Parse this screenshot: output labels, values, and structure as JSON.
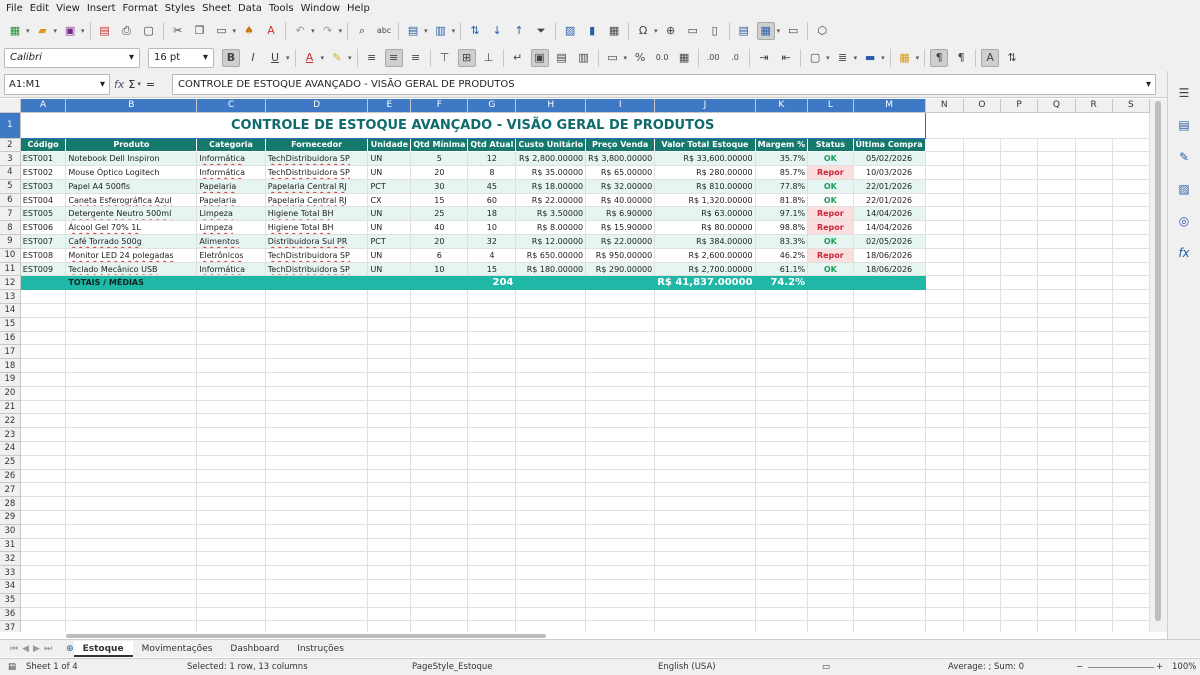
{
  "menu": [
    "File",
    "Edit",
    "View",
    "Insert",
    "Format",
    "Styles",
    "Sheet",
    "Data",
    "Tools",
    "Window",
    "Help"
  ],
  "toolbar": {
    "font_name": "Calibri",
    "font_size": "16 pt"
  },
  "formula_bar": {
    "cell_ref": "A1:M1",
    "fx": "fx",
    "sum": "Σ",
    "eq": "=",
    "content": "CONTROLE DE ESTOQUE AVANÇADO - VISÃO GERAL DE PRODUTOS"
  },
  "columns": [
    "A",
    "B",
    "C",
    "D",
    "E",
    "F",
    "G",
    "H",
    "I",
    "J",
    "K",
    "L",
    "M",
    "N",
    "O",
    "P",
    "Q",
    "R",
    "S"
  ],
  "sheet": {
    "title": "CONTROLE DE ESTOQUE AVANÇADO - VISÃO GERAL DE PRODUTOS",
    "headers": [
      "Código",
      "Produto",
      "Categoria",
      "Fornecedor",
      "Unidade",
      "Qtd Mínima",
      "Qtd Atual",
      "Custo Unitário",
      "Preço Venda",
      "Valor Total Estoque",
      "Margem %",
      "Status",
      "Última Compra"
    ],
    "rows": [
      [
        "EST001",
        "Notebook Dell Inspiron",
        "Informática",
        "TechDistribuidora SP",
        "UN",
        "5",
        "12",
        "R$ 2,800.00000",
        "R$ 3,800.00000",
        "R$ 33,600.00000",
        "35.7%",
        "OK",
        "05/02/2026"
      ],
      [
        "EST002",
        "Mouse Óptico Logitech",
        "Informática",
        "TechDistribuidora SP",
        "UN",
        "20",
        "8",
        "R$ 35.00000",
        "R$ 65.00000",
        "R$ 280.00000",
        "85.7%",
        "Repor",
        "10/03/2026"
      ],
      [
        "EST003",
        "Papel A4 500fls",
        "Papelaria",
        "Papelaria Central RJ",
        "PCT",
        "30",
        "45",
        "R$ 18.00000",
        "R$ 32.00000",
        "R$ 810.00000",
        "77.8%",
        "OK",
        "22/01/2026"
      ],
      [
        "EST004",
        "Caneta Esferográfica Azul",
        "Papelaria",
        "Papelaria Central RJ",
        "CX",
        "15",
        "60",
        "R$ 22.00000",
        "R$ 40.00000",
        "R$ 1,320.00000",
        "81.8%",
        "OK",
        "22/01/2026"
      ],
      [
        "EST005",
        "Detergente Neutro 500ml",
        "Limpeza",
        "Higiene Total BH",
        "UN",
        "25",
        "18",
        "R$ 3.50000",
        "R$ 6.90000",
        "R$ 63.00000",
        "97.1%",
        "Repor",
        "14/04/2026"
      ],
      [
        "EST006",
        "Álcool Gel 70% 1L",
        "Limpeza",
        "Higiene Total BH",
        "UN",
        "40",
        "10",
        "R$ 8.00000",
        "R$ 15.90000",
        "R$ 80.00000",
        "98.8%",
        "Repor",
        "14/04/2026"
      ],
      [
        "EST007",
        "Café Torrado 500g",
        "Alimentos",
        "Distribuidora Sul PR",
        "PCT",
        "20",
        "32",
        "R$ 12.00000",
        "R$ 22.00000",
        "R$ 384.00000",
        "83.3%",
        "OK",
        "02/05/2026"
      ],
      [
        "EST008",
        "Monitor LED 24 polegadas",
        "Eletrônicos",
        "TechDistribuidora SP",
        "UN",
        "6",
        "4",
        "R$ 650.00000",
        "R$ 950.00000",
        "R$ 2,600.00000",
        "46.2%",
        "Repor",
        "18/06/2026"
      ],
      [
        "EST009",
        "Teclado Mecânico USB",
        "Informática",
        "TechDistribuidora SP",
        "UN",
        "10",
        "15",
        "R$ 180.00000",
        "R$ 290.00000",
        "R$ 2,700.00000",
        "61.1%",
        "OK",
        "18/06/2026"
      ]
    ],
    "totals": {
      "label": "TOTAIS / MÉDIAS",
      "qty": "204",
      "value": "R$ 41,837.00000",
      "margin": "74.2%"
    },
    "row_numbers": [
      "1",
      "2",
      "3",
      "4",
      "5",
      "6",
      "7",
      "8",
      "9",
      "10",
      "11",
      "12",
      "13",
      "14",
      "15",
      "16",
      "17",
      "18",
      "19",
      "20",
      "21",
      "22",
      "23",
      "24",
      "25",
      "26",
      "27",
      "28",
      "29",
      "30",
      "31",
      "32",
      "33",
      "34",
      "35",
      "36",
      "37"
    ]
  },
  "tabs": [
    "Estoque",
    "Movimentações",
    "Dashboard",
    "Instruções"
  ],
  "status": {
    "sheet": "Sheet 1 of 4",
    "selection": "Selected: 1 row, 13 columns",
    "page_style": "PageStyle_Estoque",
    "language": "English (USA)",
    "summary": "Average: ; Sum: 0",
    "zoom": "100%"
  },
  "colors": {
    "header_bg": "#17796d",
    "total_bg": "#1fb8a7",
    "title": "#0f6b6b",
    "ok": "#1f9e5a",
    "repor": "#c6283a"
  }
}
